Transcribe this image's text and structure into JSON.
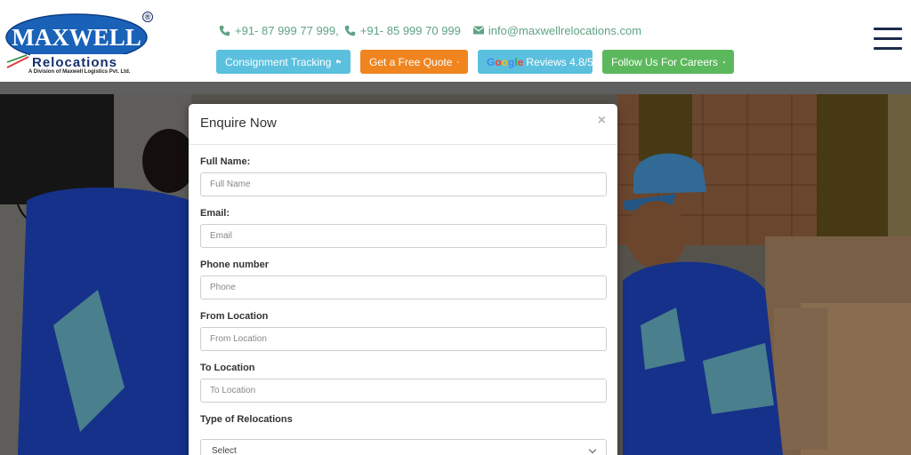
{
  "header": {
    "logo": {
      "brand_top": "MAXWELL",
      "brand_bottom": "Relocations",
      "registered": "®",
      "tagline": "A Division of Maxwell Logistics Pvt. Ltd."
    },
    "contact": {
      "phone1": "+91- 87 999 77 999,",
      "phone2": "+91- 85 999 70 999",
      "email": "info@maxwellrelocations.com"
    },
    "buttons": {
      "tracking": "Consignment Tracking",
      "quote": "Get a Free Quote",
      "reviews_letters": [
        "G",
        "o",
        "o",
        "g",
        "l",
        "e"
      ],
      "reviews": "Reviews 4.8/5",
      "careers": "Follow Us For Careers"
    },
    "icons": {
      "phone": "phone-icon",
      "email": "envelope-icon",
      "truck": "truck-icon",
      "info": "info-circle-icon",
      "hand": "hand-icon",
      "menu": "hamburger-menu-icon"
    }
  },
  "modal": {
    "title": "Enquire Now",
    "close": "×",
    "fields": [
      {
        "label": "Full Name:",
        "placeholder": "Full Name"
      },
      {
        "label": "Email:",
        "placeholder": "Email"
      },
      {
        "label": "Phone number",
        "placeholder": "Phone"
      },
      {
        "label": "From Location",
        "placeholder": "From Location"
      },
      {
        "label": "To Location",
        "placeholder": "To Location"
      }
    ],
    "relocation": {
      "label": "Type of Relocations",
      "selected": "Select"
    }
  },
  "colors": {
    "brand_blue": "#1a5fb4",
    "contact_green": "#5fa383",
    "btn_info": "#5bc0de",
    "btn_orange": "#f0841f",
    "btn_green": "#5cb85c"
  }
}
